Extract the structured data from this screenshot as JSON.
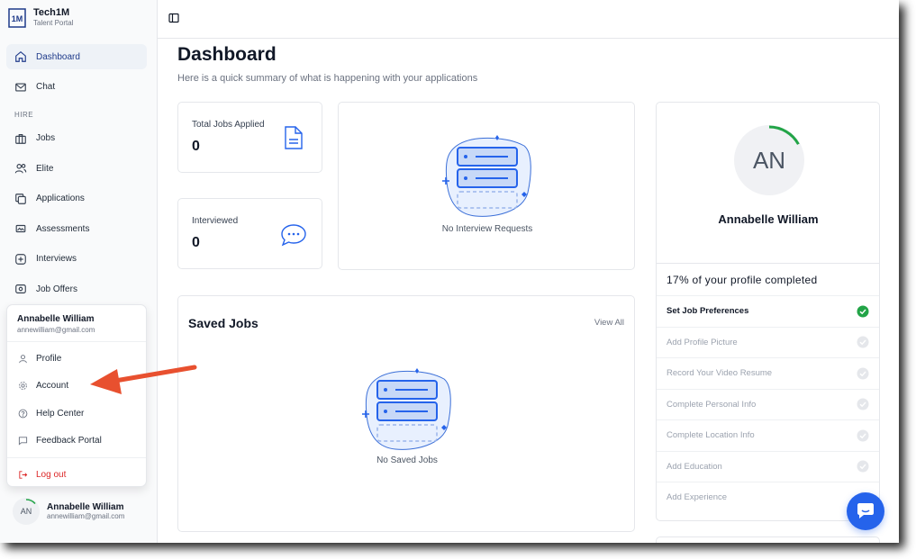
{
  "brand": {
    "name": "Tech1M",
    "subtitle": "Talent Portal",
    "logo_text": "1M"
  },
  "sidebar": {
    "items": [
      {
        "label": "Dashboard",
        "icon": "home-icon",
        "active": true
      },
      {
        "label": "Chat",
        "icon": "mail-icon"
      }
    ],
    "section_hire": "HIRE",
    "hire_items": [
      {
        "label": "Jobs",
        "icon": "briefcase-icon"
      },
      {
        "label": "Elite",
        "icon": "users-icon"
      },
      {
        "label": "Applications",
        "icon": "copy-icon"
      },
      {
        "label": "Assessments",
        "icon": "image-icon"
      },
      {
        "label": "Interviews",
        "icon": "plus-square-icon"
      },
      {
        "label": "Job Offers",
        "icon": "offer-icon"
      }
    ]
  },
  "popup": {
    "name": "Annabelle William",
    "email": "annewilliam@gmail.com",
    "items": [
      {
        "label": "Profile",
        "icon": "user-icon"
      },
      {
        "label": "Account",
        "icon": "gear-icon"
      },
      {
        "label": "Help Center",
        "icon": "help-icon"
      },
      {
        "label": "Feedback Portal",
        "icon": "message-icon"
      }
    ],
    "logout": "Log out"
  },
  "footer_user": {
    "initials": "AN",
    "name": "Annabelle William",
    "email": "annewilliam@gmail.com"
  },
  "main": {
    "title": "Dashboard",
    "subtitle": "Here is a quick summary of what is happening with your applications",
    "stats": [
      {
        "label": "Total Jobs Applied",
        "value": "0",
        "icon": "document-icon"
      },
      {
        "label": "Interviewed",
        "value": "0",
        "icon": "chat-bubble-icon"
      }
    ],
    "interview_empty": "No Interview Requests",
    "saved_jobs": {
      "title": "Saved Jobs",
      "view_all": "View All",
      "empty": "No Saved Jobs"
    }
  },
  "profile": {
    "initials": "AN",
    "name": "Annabelle William",
    "completion_percent": 17,
    "completion_text": "17% of your profile completed",
    "checklist": [
      {
        "label": "Set Job Preferences",
        "done": true
      },
      {
        "label": "Add Profile Picture",
        "done": false
      },
      {
        "label": "Record Your Video Resume",
        "done": false
      },
      {
        "label": "Complete Personal Info",
        "done": false
      },
      {
        "label": "Complete Location Info",
        "done": false
      },
      {
        "label": "Add Education",
        "done": false
      },
      {
        "label": "Add Experience",
        "done": false
      }
    ]
  },
  "colors": {
    "accent": "#2563eb",
    "success": "#22a447",
    "danger": "#dc2626",
    "arrow": "#e8502f"
  }
}
